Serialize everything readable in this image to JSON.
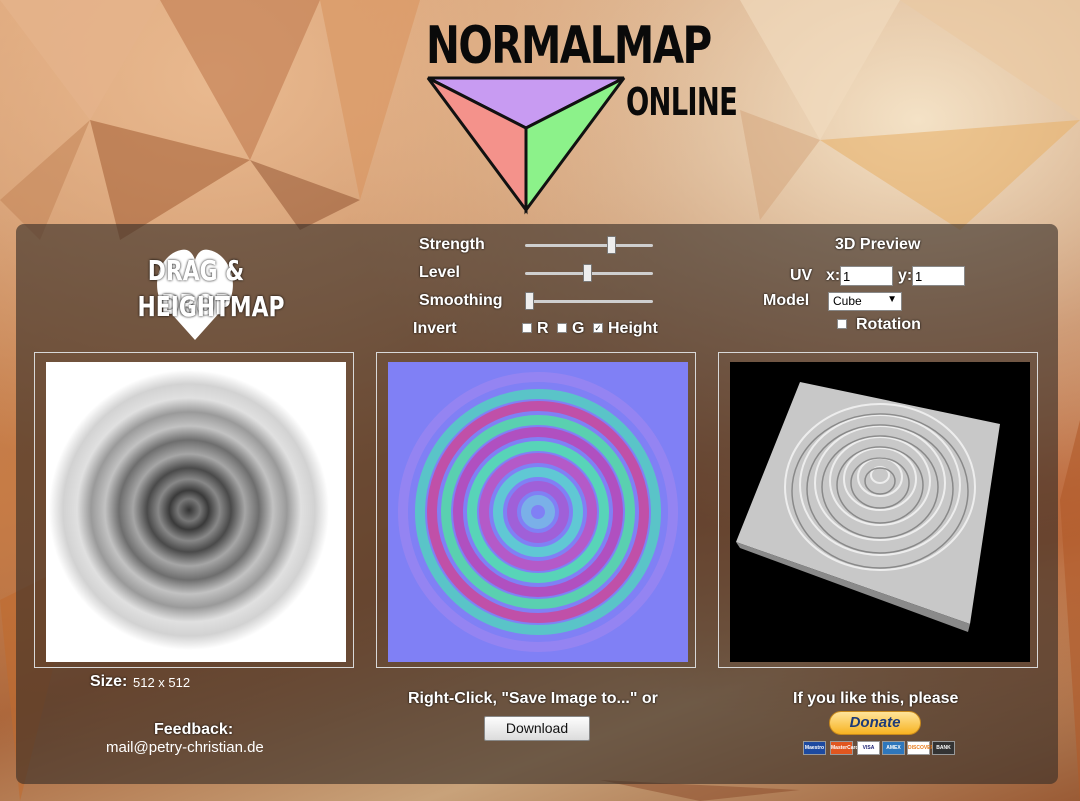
{
  "logo": {
    "title": "NORMALMAP",
    "subtitle": "ONLINE"
  },
  "dragdrop": {
    "line1": "DRAG & DROP",
    "line2": "HEIGHTMAP"
  },
  "controls": {
    "strength_label": "Strength",
    "level_label": "Level",
    "smoothing_label": "Smoothing",
    "invert_label": "Invert",
    "strength_value": 0.69,
    "level_value": 0.49,
    "smoothing_value": 0.0,
    "invert": {
      "r_label": "R",
      "r_checked": false,
      "g_label": "G",
      "g_checked": false,
      "height_label": "Height",
      "height_checked": true
    }
  },
  "preview3d": {
    "title": "3D Preview",
    "uv_label": "UV",
    "x_label": "x:",
    "x_value": "1",
    "y_label": "y:",
    "y_value": "1",
    "model_label": "Model",
    "model_value": "Cube",
    "rotation_label": "Rotation",
    "rotation_checked": false
  },
  "info": {
    "size_label": "Size:",
    "size_value": "512 x 512",
    "feedback_label": "Feedback:",
    "feedback_email": "mail@petry-christian.de"
  },
  "save": {
    "text": "Right-Click, \"Save Image to...\" or",
    "download_label": "Download"
  },
  "donate": {
    "text": "If you like this, please",
    "button_label": "Donate",
    "cards": [
      "Maestro",
      "MasterCard",
      "VISA",
      "AMEX",
      "DISCOVER",
      "BANK"
    ]
  },
  "colors": {
    "tri_top": "#c89bf2",
    "tri_left": "#f4928b",
    "tri_right": "#8cf28a",
    "panel": "rgba(55,45,38,0.62)"
  }
}
